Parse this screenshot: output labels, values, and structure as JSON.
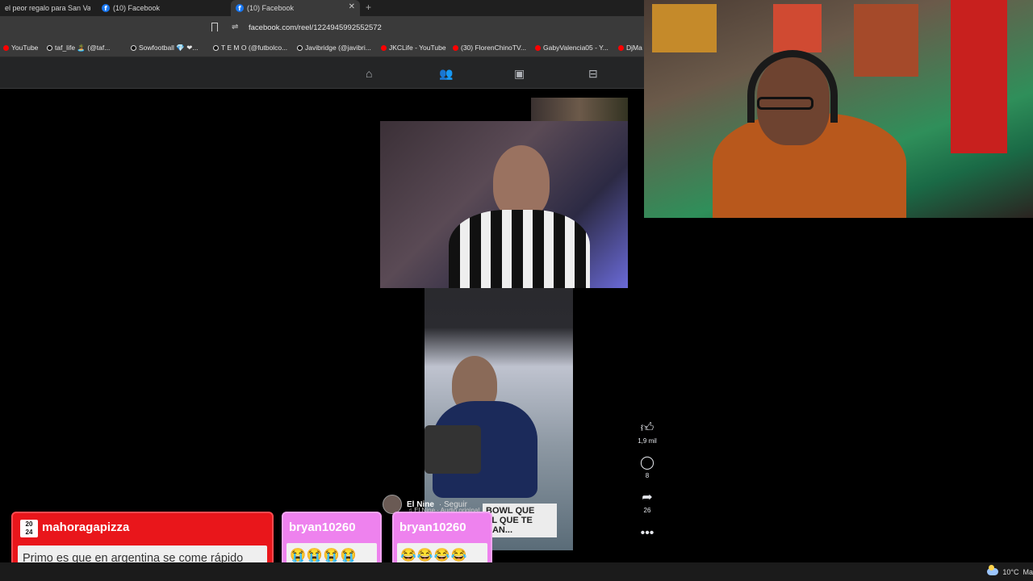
{
  "browser": {
    "tabs": [
      {
        "label": "el peor regalo para San Valen",
        "active": false
      },
      {
        "label": "(10) Facebook",
        "active": false
      },
      {
        "label": "(10) Facebook",
        "active": true
      }
    ],
    "new_tab_label": "+",
    "url": "facebook.com/reel/1224945992552572"
  },
  "bookmarks": [
    {
      "label": "YouTube",
      "icon": "youtube-icon"
    },
    {
      "label": "taf_life 🏝️ (@taf...",
      "icon": "tiktok-icon"
    },
    {
      "label": "Sowfootball 💎 ❤...",
      "icon": "tiktok-icon"
    },
    {
      "label": "T E M O (@futbolco...",
      "icon": "tiktok-icon"
    },
    {
      "label": "Javibridge (@javibri...",
      "icon": "tiktok-icon"
    },
    {
      "label": "JKCLife - YouTube",
      "icon": "youtube-icon"
    },
    {
      "label": "(30) FlorenChinoTV...",
      "icon": "youtube-icon"
    },
    {
      "label": "GabyValencia05 - Y...",
      "icon": "youtube-icon"
    },
    {
      "label": "DjMa",
      "icon": "youtube-icon"
    }
  ],
  "fb_nav": {
    "icons": [
      "home-icon",
      "friends-icon",
      "watch-icon",
      "marketplace-icon"
    ]
  },
  "reel": {
    "author": "El Nine",
    "follow_label": "· Seguir",
    "audio": "♫ El Nine · Audio original",
    "caption_overlay": "BOWL QUE\nEL QUE TE\nDAN...",
    "actions": {
      "likes": "1,9 mil",
      "comments": "8",
      "shares": "26"
    }
  },
  "chat": [
    {
      "user": "mahoragapizza",
      "badge": "20\n24",
      "message": "Primo es que en argentina se come rápido",
      "color": "#e9161b"
    },
    {
      "user": "bryan10260",
      "message": "😭😭😭😭",
      "color": "#ee82ee"
    },
    {
      "user": "bryan10260",
      "message": "😂😂😂😂",
      "color": "#ee82ee"
    }
  ],
  "taskbar": {
    "temperature": "10°C",
    "weather_text": "Ma"
  }
}
